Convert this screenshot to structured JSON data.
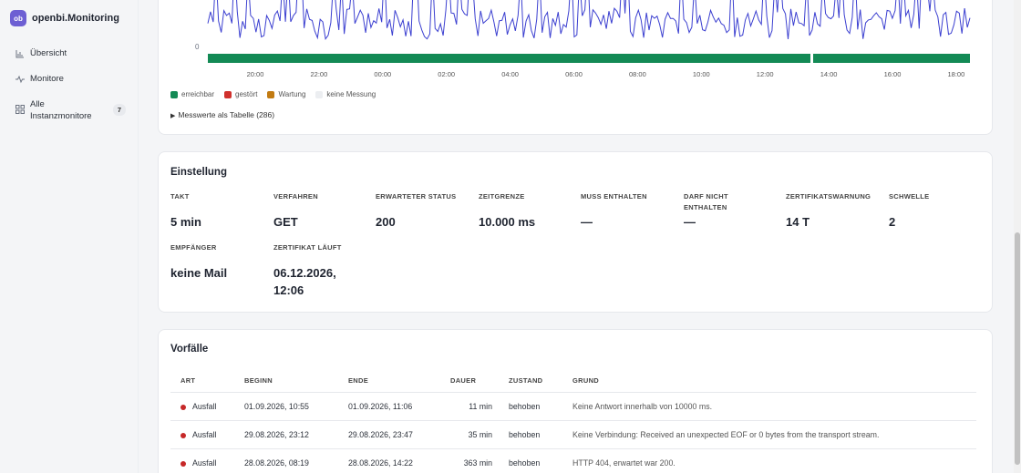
{
  "app": {
    "logo_text": "ob",
    "name": "openbi.Monitoring"
  },
  "sidebar": {
    "items": [
      {
        "label": "Übersicht",
        "icon": "chart-icon"
      },
      {
        "label": "Monitore",
        "icon": "pulse-icon"
      },
      {
        "label": "Alle Instanzmonitore",
        "icon": "grid-icon",
        "badge": "7"
      }
    ]
  },
  "chart": {
    "zero_label": "0",
    "time_ticks": [
      "20:00",
      "22:00",
      "00:00",
      "02:00",
      "04:00",
      "06:00",
      "08:00",
      "10:00",
      "12:00",
      "14:00",
      "16:00",
      "18:00"
    ],
    "legend": [
      {
        "label": "erreichbar",
        "color": "#138a55"
      },
      {
        "label": "gestört",
        "color": "#d0312d"
      },
      {
        "label": "Wartung",
        "color": "#c27b12"
      },
      {
        "label": "keine Messung",
        "color": "#eceef1"
      }
    ],
    "table_toggle": "Messwerte als Tabelle (286)"
  },
  "einstellung": {
    "title": "Einstellung",
    "items": [
      {
        "label": "TAKT",
        "value": "5 min"
      },
      {
        "label": "VERFAHREN",
        "value": "GET"
      },
      {
        "label": "ERWARTETER STATUS",
        "value": "200"
      },
      {
        "label": "ZEITGRENZE",
        "value": "10.000 ms"
      },
      {
        "label": "MUSS ENTHALTEN",
        "value": "—"
      },
      {
        "label": "DARF NICHT ENTHALTEN",
        "value": "—"
      },
      {
        "label": "ZERTIFIKATSWARNUNG",
        "value": "14 T"
      },
      {
        "label": "SCHWELLE",
        "value": "2"
      },
      {
        "label": "EMPFÄNGER",
        "value": "keine Mail"
      },
      {
        "label": "ZERTIFIKAT LÄUFT",
        "value": "06.12.2026, 12:06"
      }
    ]
  },
  "vorfaelle": {
    "title": "Vorfälle",
    "columns": [
      "ART",
      "BEGINN",
      "ENDE",
      "DAUER",
      "ZUSTAND",
      "GRUND"
    ],
    "rows": [
      {
        "art": "Ausfall",
        "beginn": "01.09.2026, 10:55",
        "ende": "01.09.2026, 11:06",
        "dauer": "11 min",
        "zustand": "behoben",
        "grund": "Keine Antwort innerhalb von 10000 ms."
      },
      {
        "art": "Ausfall",
        "beginn": "29.08.2026, 23:12",
        "ende": "29.08.2026, 23:47",
        "dauer": "35 min",
        "zustand": "behoben",
        "grund": "Keine Verbindung: Received an unexpected EOF or 0 bytes from the transport stream."
      },
      {
        "art": "Ausfall",
        "beginn": "28.08.2026, 08:19",
        "ende": "28.08.2026, 14:22",
        "dauer": "363 min",
        "zustand": "behoben",
        "grund": "HTTP 404, erwartet war 200."
      }
    ]
  },
  "colors": {
    "accent": "#6d5fd3",
    "line": "#3b3fd0",
    "ok": "#138a55",
    "incident": "#c62828"
  }
}
